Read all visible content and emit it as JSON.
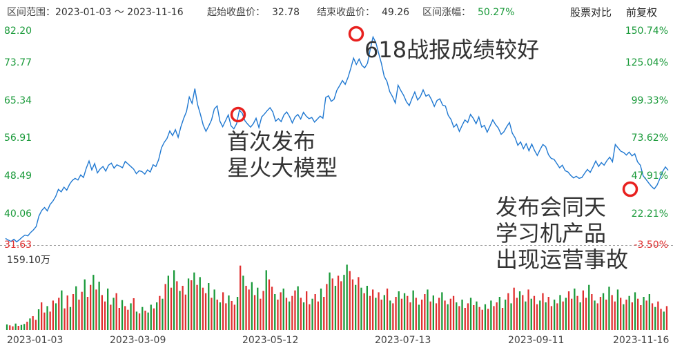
{
  "header": {
    "range_label": "区间范围：",
    "range_value": "2023-01-03 ～ 2023-11-16",
    "start_label": "起始收盘价：",
    "start_value": "32.78",
    "end_label": "结束收盘价：",
    "end_value": "49.26",
    "change_label": "区间涨幅：",
    "change_value": "50.27%",
    "compare_button": "股票对比",
    "adjust_button": "前复权"
  },
  "colors": {
    "line": "#1f78d1",
    "up": "#e03030",
    "down": "#1a9a3a",
    "marker": "#e8201e"
  },
  "price_axis": {
    "left_labels": [
      "82.20",
      "73.77",
      "65.34",
      "56.91",
      "48.49",
      "40.06",
      "31.63"
    ],
    "right_labels": [
      "150.74%",
      "125.04%",
      "99.33%",
      "73.62%",
      "47.91%",
      "22.21%",
      "-3.50%"
    ]
  },
  "volume_axis": {
    "max_label": "159.10万"
  },
  "x_axis": {
    "labels": [
      "2023-01-03",
      "2023-03-09",
      "2023-05-12",
      "2023-07-13",
      "2023-09-11",
      "2023-11-16"
    ]
  },
  "annotations": [
    {
      "text": "618战报成绩较好"
    },
    {
      "text": "首次发布\n星火大模型"
    },
    {
      "text": "发布会同天\n学习机产品\n出现运营事故"
    }
  ],
  "chart_data": {
    "type": "line",
    "ylim": [
      31.63,
      82.2
    ],
    "x_start": "2023-01-03",
    "x_end": "2023-11-16",
    "series": [
      {
        "values": [
          33.2,
          32.8,
          32.5,
          33.0,
          32.4,
          32.9,
          33.5,
          34.0,
          33.8,
          34.6,
          35.2,
          36.0,
          38.5,
          39.8,
          40.5,
          39.7,
          41.2,
          42.0,
          43.1,
          44.8,
          44.2,
          45.3,
          44.6,
          46.0,
          46.9,
          47.4,
          47.0,
          48.2,
          47.6,
          49.8,
          51.5,
          49.4,
          50.9,
          48.7,
          49.6,
          50.2,
          49.1,
          50.5,
          51.0,
          49.8,
          50.6,
          50.3,
          49.9,
          51.4,
          50.8,
          50.2,
          49.6,
          48.5,
          49.2,
          49.0,
          48.4,
          49.4,
          48.9,
          50.6,
          50.2,
          51.8,
          54.6,
          55.9,
          56.8,
          58.6,
          57.5,
          58.9,
          57.1,
          59.6,
          61.6,
          63.2,
          66.6,
          65.1,
          68.6,
          64.8,
          62.5,
          60.0,
          58.5,
          59.8,
          61.2,
          63.8,
          64.5,
          60.9,
          59.6,
          61.0,
          62.4,
          59.8,
          59.1,
          60.3,
          63.5,
          62.8,
          61.0,
          60.2,
          59.5,
          60.3,
          61.6,
          59.4,
          61.9,
          62.6,
          63.4,
          64.1,
          63.1,
          60.9,
          61.5,
          60.8,
          62.4,
          63.1,
          62.0,
          60.5,
          61.9,
          62.5,
          61.4,
          63.0,
          62.1,
          61.5,
          61.8,
          60.7,
          61.4,
          62.1,
          61.6,
          66.5,
          66.9,
          65.6,
          66.1,
          68.2,
          69.3,
          70.5,
          69.6,
          71.2,
          73.4,
          75.8,
          74.3,
          75.6,
          74.1,
          73.5,
          74.6,
          77.9,
          80.8,
          79.5,
          77.0,
          74.6,
          71.5,
          70.3,
          67.9,
          66.7,
          65.2,
          69.4,
          68.1,
          67.0,
          65.5,
          64.6,
          66.3,
          67.8,
          65.9,
          66.7,
          68.3,
          66.8,
          67.2,
          66.0,
          64.4,
          65.8,
          66.2,
          64.7,
          64.5,
          62.3,
          61.3,
          59.5,
          60.2,
          58.5,
          59.9,
          61.2,
          60.6,
          62.5,
          61.6,
          60.3,
          61.9,
          59.5,
          59.9,
          58.3,
          59.7,
          61.2,
          60.1,
          59.3,
          57.8,
          58.4,
          59.6,
          60.6,
          58.1,
          57.0,
          55.2,
          56.0,
          54.4,
          55.6,
          53.9,
          55.5,
          54.0,
          52.8,
          54.2,
          55.4,
          54.9,
          53.0,
          52.1,
          51.9,
          50.9,
          49.9,
          50.5,
          49.2,
          48.9,
          48.1,
          47.5,
          47.9,
          47.4,
          47.6,
          48.6,
          49.5,
          48.8,
          50.1,
          51.5,
          50.2,
          51.1,
          50.5,
          51.6,
          52.4,
          51.3,
          55.4,
          54.6,
          53.8,
          53.5,
          52.9,
          53.6,
          52.7,
          53.2,
          51.3,
          50.5,
          48.0,
          47.2,
          46.3,
          45.5,
          44.9,
          45.8,
          47.3,
          49.0,
          50.1,
          49.3
        ]
      }
    ],
    "volume_max": 159.1,
    "volume": [
      {
        "v": 12,
        "c": "down"
      },
      {
        "v": 10,
        "c": "up"
      },
      {
        "v": 8,
        "c": "up"
      },
      {
        "v": 14,
        "c": "down"
      },
      {
        "v": 9,
        "c": "up"
      },
      {
        "v": 11,
        "c": "down"
      },
      {
        "v": 13,
        "c": "down"
      },
      {
        "v": 18,
        "c": "up"
      },
      {
        "v": 25,
        "c": "down"
      },
      {
        "v": 30,
        "c": "up"
      },
      {
        "v": 22,
        "c": "up"
      },
      {
        "v": 45,
        "c": "down"
      },
      {
        "v": 60,
        "c": "up"
      },
      {
        "v": 38,
        "c": "up"
      },
      {
        "v": 52,
        "c": "down"
      },
      {
        "v": 40,
        "c": "up"
      },
      {
        "v": 64,
        "c": "up"
      },
      {
        "v": 58,
        "c": "down"
      },
      {
        "v": 70,
        "c": "up"
      },
      {
        "v": 86,
        "c": "down"
      },
      {
        "v": 47,
        "c": "up"
      },
      {
        "v": 75,
        "c": "up"
      },
      {
        "v": 50,
        "c": "down"
      },
      {
        "v": 78,
        "c": "up"
      },
      {
        "v": 95,
        "c": "down"
      },
      {
        "v": 66,
        "c": "up"
      },
      {
        "v": 83,
        "c": "up"
      },
      {
        "v": 110,
        "c": "down"
      },
      {
        "v": 72,
        "c": "up"
      },
      {
        "v": 98,
        "c": "up"
      },
      {
        "v": 120,
        "c": "down"
      },
      {
        "v": 88,
        "c": "up"
      },
      {
        "v": 105,
        "c": "down"
      },
      {
        "v": 76,
        "c": "up"
      },
      {
        "v": 62,
        "c": "up"
      },
      {
        "v": 90,
        "c": "down"
      },
      {
        "v": 55,
        "c": "up"
      },
      {
        "v": 70,
        "c": "down"
      },
      {
        "v": 80,
        "c": "up"
      },
      {
        "v": 48,
        "c": "up"
      },
      {
        "v": 65,
        "c": "down"
      },
      {
        "v": 52,
        "c": "up"
      },
      {
        "v": 44,
        "c": "up"
      },
      {
        "v": 58,
        "c": "down"
      },
      {
        "v": 69,
        "c": "up"
      },
      {
        "v": 40,
        "c": "down"
      },
      {
        "v": 36,
        "c": "up"
      },
      {
        "v": 50,
        "c": "down"
      },
      {
        "v": 42,
        "c": "up"
      },
      {
        "v": 38,
        "c": "down"
      },
      {
        "v": 55,
        "c": "down"
      },
      {
        "v": 47,
        "c": "up"
      },
      {
        "v": 60,
        "c": "down"
      },
      {
        "v": 74,
        "c": "up"
      },
      {
        "v": 68,
        "c": "down"
      },
      {
        "v": 100,
        "c": "up"
      },
      {
        "v": 118,
        "c": "down"
      },
      {
        "v": 92,
        "c": "up"
      },
      {
        "v": 130,
        "c": "down"
      },
      {
        "v": 106,
        "c": "up"
      },
      {
        "v": 85,
        "c": "down"
      },
      {
        "v": 96,
        "c": "up"
      },
      {
        "v": 77,
        "c": "up"
      },
      {
        "v": 112,
        "c": "down"
      },
      {
        "v": 108,
        "c": "up"
      },
      {
        "v": 125,
        "c": "down"
      },
      {
        "v": 98,
        "c": "up"
      },
      {
        "v": 115,
        "c": "down"
      },
      {
        "v": 92,
        "c": "up"
      },
      {
        "v": 80,
        "c": "up"
      },
      {
        "v": 102,
        "c": "down"
      },
      {
        "v": 70,
        "c": "up"
      },
      {
        "v": 88,
        "c": "down"
      },
      {
        "v": 66,
        "c": "up"
      },
      {
        "v": 60,
        "c": "down"
      },
      {
        "v": 82,
        "c": "up"
      },
      {
        "v": 58,
        "c": "up"
      },
      {
        "v": 75,
        "c": "down"
      },
      {
        "v": 63,
        "c": "up"
      },
      {
        "v": 55,
        "c": "up"
      },
      {
        "v": 72,
        "c": "down"
      },
      {
        "v": 140,
        "c": "up"
      },
      {
        "v": 118,
        "c": "down"
      },
      {
        "v": 96,
        "c": "up"
      },
      {
        "v": 88,
        "c": "up"
      },
      {
        "v": 104,
        "c": "down"
      },
      {
        "v": 76,
        "c": "up"
      },
      {
        "v": 92,
        "c": "down"
      },
      {
        "v": 68,
        "c": "up"
      },
      {
        "v": 85,
        "c": "up"
      },
      {
        "v": 130,
        "c": "down"
      },
      {
        "v": 110,
        "c": "up"
      },
      {
        "v": 94,
        "c": "up"
      },
      {
        "v": 78,
        "c": "down"
      },
      {
        "v": 66,
        "c": "up"
      },
      {
        "v": 82,
        "c": "up"
      },
      {
        "v": 90,
        "c": "down"
      },
      {
        "v": 70,
        "c": "up"
      },
      {
        "v": 62,
        "c": "down"
      },
      {
        "v": 74,
        "c": "up"
      },
      {
        "v": 86,
        "c": "up"
      },
      {
        "v": 95,
        "c": "down"
      },
      {
        "v": 70,
        "c": "up"
      },
      {
        "v": 60,
        "c": "down"
      },
      {
        "v": 84,
        "c": "up"
      },
      {
        "v": 56,
        "c": "up"
      },
      {
        "v": 68,
        "c": "down"
      },
      {
        "v": 78,
        "c": "up"
      },
      {
        "v": 62,
        "c": "up"
      },
      {
        "v": 90,
        "c": "down"
      },
      {
        "v": 72,
        "c": "up"
      },
      {
        "v": 100,
        "c": "up"
      },
      {
        "v": 125,
        "c": "down"
      },
      {
        "v": 112,
        "c": "up"
      },
      {
        "v": 96,
        "c": "down"
      },
      {
        "v": 118,
        "c": "up"
      },
      {
        "v": 106,
        "c": "up"
      },
      {
        "v": 120,
        "c": "down"
      },
      {
        "v": 142,
        "c": "down"
      },
      {
        "v": 128,
        "c": "up"
      },
      {
        "v": 110,
        "c": "up"
      },
      {
        "v": 98,
        "c": "down"
      },
      {
        "v": 115,
        "c": "up"
      },
      {
        "v": 92,
        "c": "down"
      },
      {
        "v": 80,
        "c": "up"
      },
      {
        "v": 96,
        "c": "down"
      },
      {
        "v": 74,
        "c": "up"
      },
      {
        "v": 88,
        "c": "up"
      },
      {
        "v": 70,
        "c": "down"
      },
      {
        "v": 82,
        "c": "up"
      },
      {
        "v": 66,
        "c": "up"
      },
      {
        "v": 76,
        "c": "down"
      },
      {
        "v": 90,
        "c": "up"
      },
      {
        "v": 64,
        "c": "down"
      },
      {
        "v": 58,
        "c": "up"
      },
      {
        "v": 72,
        "c": "up"
      },
      {
        "v": 84,
        "c": "down"
      },
      {
        "v": 68,
        "c": "up"
      },
      {
        "v": 80,
        "c": "down"
      },
      {
        "v": 74,
        "c": "up"
      },
      {
        "v": 60,
        "c": "up"
      },
      {
        "v": 86,
        "c": "down"
      },
      {
        "v": 70,
        "c": "up"
      },
      {
        "v": 55,
        "c": "down"
      },
      {
        "v": 66,
        "c": "up"
      },
      {
        "v": 78,
        "c": "up"
      },
      {
        "v": 88,
        "c": "down"
      },
      {
        "v": 62,
        "c": "up"
      },
      {
        "v": 75,
        "c": "down"
      },
      {
        "v": 58,
        "c": "up"
      },
      {
        "v": 70,
        "c": "up"
      },
      {
        "v": 82,
        "c": "down"
      },
      {
        "v": 64,
        "c": "up"
      },
      {
        "v": 56,
        "c": "down"
      },
      {
        "v": 68,
        "c": "up"
      },
      {
        "v": 74,
        "c": "up"
      },
      {
        "v": 60,
        "c": "down"
      },
      {
        "v": 52,
        "c": "up"
      },
      {
        "v": 66,
        "c": "down"
      },
      {
        "v": 48,
        "c": "up"
      },
      {
        "v": 58,
        "c": "up"
      },
      {
        "v": 70,
        "c": "down"
      },
      {
        "v": 54,
        "c": "up"
      },
      {
        "v": 62,
        "c": "down"
      },
      {
        "v": 50,
        "c": "up"
      },
      {
        "v": 44,
        "c": "up"
      },
      {
        "v": 56,
        "c": "down"
      },
      {
        "v": 46,
        "c": "up"
      },
      {
        "v": 64,
        "c": "down"
      },
      {
        "v": 52,
        "c": "up"
      },
      {
        "v": 60,
        "c": "up"
      },
      {
        "v": 72,
        "c": "down"
      },
      {
        "v": 48,
        "c": "up"
      },
      {
        "v": 66,
        "c": "down"
      },
      {
        "v": 80,
        "c": "up"
      },
      {
        "v": 58,
        "c": "down"
      },
      {
        "v": 92,
        "c": "up"
      },
      {
        "v": 70,
        "c": "up"
      },
      {
        "v": 84,
        "c": "down"
      },
      {
        "v": 76,
        "c": "up"
      },
      {
        "v": 62,
        "c": "down"
      },
      {
        "v": 88,
        "c": "up"
      },
      {
        "v": 68,
        "c": "down"
      },
      {
        "v": 74,
        "c": "up"
      },
      {
        "v": 56,
        "c": "up"
      },
      {
        "v": 64,
        "c": "down"
      },
      {
        "v": 80,
        "c": "up"
      },
      {
        "v": 60,
        "c": "down"
      },
      {
        "v": 72,
        "c": "up"
      },
      {
        "v": 52,
        "c": "up"
      },
      {
        "v": 66,
        "c": "down"
      },
      {
        "v": 58,
        "c": "up"
      },
      {
        "v": 76,
        "c": "down"
      },
      {
        "v": 62,
        "c": "up"
      },
      {
        "v": 70,
        "c": "down"
      },
      {
        "v": 84,
        "c": "up"
      },
      {
        "v": 68,
        "c": "up"
      },
      {
        "v": 90,
        "c": "down"
      },
      {
        "v": 74,
        "c": "up"
      },
      {
        "v": 60,
        "c": "down"
      },
      {
        "v": 86,
        "c": "up"
      },
      {
        "v": 70,
        "c": "up"
      },
      {
        "v": 98,
        "c": "down"
      },
      {
        "v": 78,
        "c": "up"
      },
      {
        "v": 64,
        "c": "down"
      },
      {
        "v": 58,
        "c": "up"
      },
      {
        "v": 72,
        "c": "up"
      },
      {
        "v": 80,
        "c": "down"
      },
      {
        "v": 66,
        "c": "up"
      },
      {
        "v": 94,
        "c": "down"
      },
      {
        "v": 76,
        "c": "up"
      },
      {
        "v": 62,
        "c": "up"
      },
      {
        "v": 88,
        "c": "down"
      },
      {
        "v": 70,
        "c": "up"
      },
      {
        "v": 56,
        "c": "down"
      },
      {
        "v": 66,
        "c": "up"
      },
      {
        "v": 74,
        "c": "down"
      },
      {
        "v": 60,
        "c": "up"
      },
      {
        "v": 82,
        "c": "down"
      },
      {
        "v": 68,
        "c": "up"
      },
      {
        "v": 54,
        "c": "up"
      },
      {
        "v": 72,
        "c": "down"
      },
      {
        "v": 64,
        "c": "up"
      },
      {
        "v": 78,
        "c": "down"
      },
      {
        "v": 58,
        "c": "up"
      },
      {
        "v": 50,
        "c": "down"
      },
      {
        "v": 62,
        "c": "up"
      },
      {
        "v": 46,
        "c": "up"
      },
      {
        "v": 40,
        "c": "down"
      },
      {
        "v": 52,
        "c": "up"
      }
    ]
  }
}
